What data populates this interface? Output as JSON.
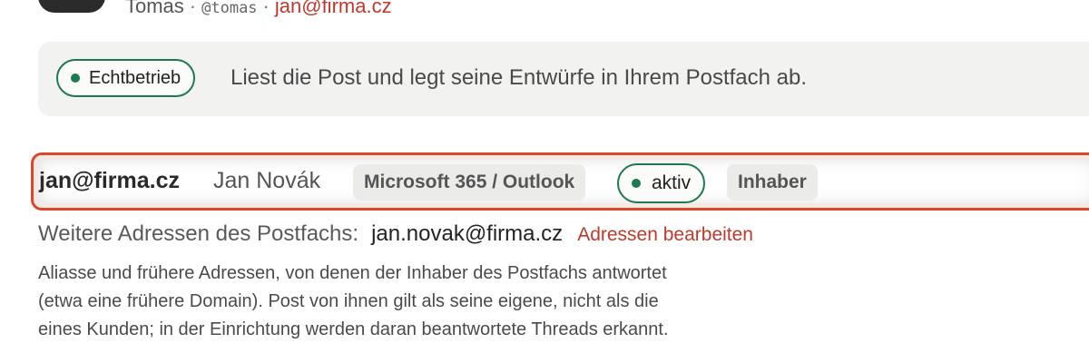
{
  "profile": {
    "name": "Tomas",
    "handle": "@tomas",
    "email": "jan@firma.cz",
    "separator": "·"
  },
  "mode": {
    "badge": "Echtbetrieb",
    "description": "Liest die Post und legt seine Entwürfe in Ihrem Postfach ab."
  },
  "mailbox": {
    "address": "jan@firma.cz",
    "name": "Jan Novák",
    "provider": "Microsoft 365 / Outlook",
    "status": "aktiv",
    "role": "Inhaber"
  },
  "addresses": {
    "label": "Weitere Adressen des Postfachs:",
    "value": "jan.novak@firma.cz",
    "edit_link": "Adressen bearbeiten",
    "help": "Aliasse und frühere Adressen, von denen der Inhaber des Postfachs antwortet (etwa eine frühere Domain). Post von ihnen gilt als seine eigene, nicht als die eines Kunden; in der Einrichtung werden daran beantwortete Threads erkannt."
  },
  "colors": {
    "accent": "#c0392b",
    "status_green": "#1c7a4f",
    "highlight_border": "#d9482b"
  }
}
